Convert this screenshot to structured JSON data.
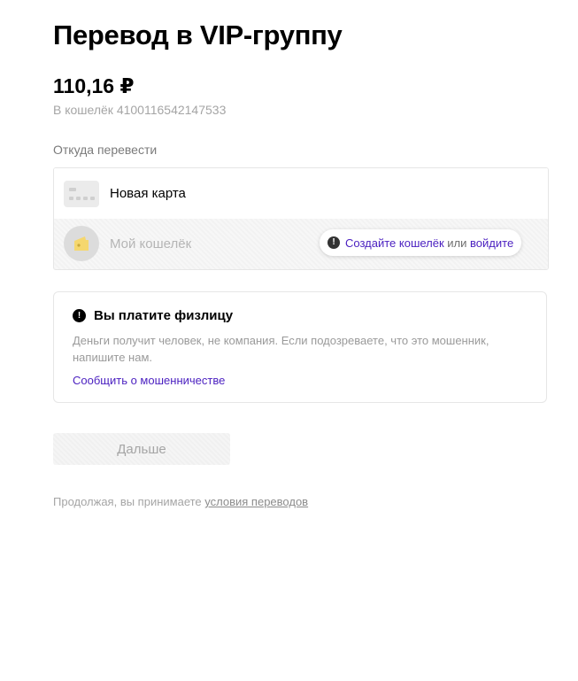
{
  "header": {
    "title": "Перевод в VIP-группу",
    "amount": "110,16 ₽",
    "wallet_line": "В кошелёк 4100116542147533"
  },
  "source": {
    "label": "Откуда перевести",
    "options": [
      {
        "label": "Новая карта",
        "icon": "card-icon",
        "enabled": true
      },
      {
        "label": "Мой кошелёк",
        "icon": "wallet-icon",
        "enabled": false
      }
    ],
    "hint": {
      "icon": "exclamation-circle-icon",
      "create_link": "Создайте кошелёк",
      "or": "или",
      "login_link": "войдите"
    }
  },
  "notice": {
    "icon": "exclamation-circle-icon",
    "title": "Вы платите физлицу",
    "body": "Деньги получит человек, не компания. Если подозреваете, что это мошенник, напишите нам.",
    "report_link": "Сообщить о мошенничестве"
  },
  "next_button": {
    "label": "Дальше",
    "disabled": true
  },
  "terms": {
    "text": "Продолжая, вы принимаете",
    "link": "условия переводов"
  },
  "colors": {
    "accent_link": "#4a1fc0",
    "muted_text": "#a5a5a5",
    "wallet_icon": "#f5d76e"
  },
  "excl_glyph": "!"
}
